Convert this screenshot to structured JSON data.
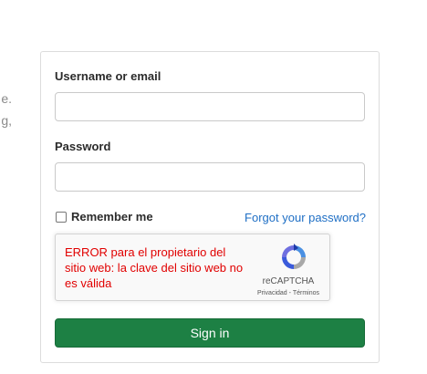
{
  "side_text": {
    "line1": "e.",
    "line2": "g,"
  },
  "form": {
    "username_label": "Username or email",
    "username_value": "",
    "password_label": "Password",
    "password_value": "",
    "remember_label": "Remember me",
    "remember_checked": false,
    "forgot_link": "Forgot your password?",
    "signin_button": "Sign in"
  },
  "recaptcha": {
    "error": "ERROR para el propietario del sitio web: la clave del sitio web no es válida",
    "brand": "reCAPTCHA",
    "privacy": "Privacidad",
    "separator": "-",
    "terms": "Términos"
  },
  "colors": {
    "primary_button": "#1d8044",
    "link": "#1f6fc5",
    "error": "#e10000"
  }
}
